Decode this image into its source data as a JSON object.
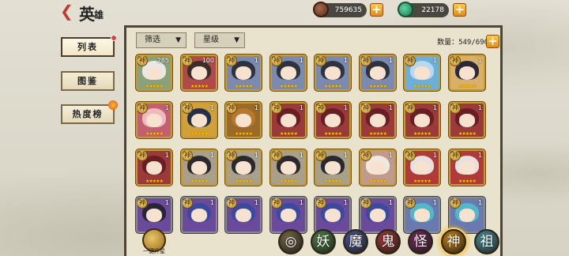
{
  "header": {
    "title_main": "英",
    "title_small": "雄",
    "coins": "759635",
    "jade": "22178",
    "plus": "+"
  },
  "sidebar": {
    "items": [
      {
        "label": "列表"
      },
      {
        "label": "图鉴"
      },
      {
        "label": "热度榜"
      }
    ]
  },
  "filters": {
    "filter_label": "筛选",
    "star_label": "星级",
    "count_label": "数量：549/690",
    "arrow": "▼"
  },
  "cards": [
    {
      "badge": "神",
      "level": "285",
      "hair": "#e8e8e8",
      "bg": "#8aa27a",
      "stars": "★★★★★"
    },
    {
      "badge": "神",
      "level": "100",
      "hair": "#3a2e2a",
      "bg": "#b04a4a",
      "stars": "★★★★★"
    },
    {
      "badge": "神",
      "level": "1",
      "hair": "#2f3340",
      "bg": "#7a8ab0",
      "stars": "★★★★★"
    },
    {
      "badge": "神",
      "level": "1",
      "hair": "#2f3340",
      "bg": "#7a8ab0",
      "stars": "★★★★★"
    },
    {
      "badge": "神",
      "level": "1",
      "hair": "#2f3340",
      "bg": "#7a8ab0",
      "stars": "★★★★★"
    },
    {
      "badge": "神",
      "level": "1",
      "hair": "#2f3340",
      "bg": "#7a8ab0",
      "stars": "★★★★★"
    },
    {
      "badge": "神",
      "level": "1",
      "hair": "#bcd8f0",
      "bg": "#6ab0d8",
      "stars": "★★★★★"
    },
    {
      "badge": "神",
      "level": "1",
      "hair": "#2a2a3a",
      "bg": "#d8b06a",
      "stars": "★★★★★"
    },
    {
      "badge": "神",
      "level": "1",
      "hair": "#f0b8c0",
      "bg": "#c06070",
      "stars": "★★★★★"
    },
    {
      "badge": "神",
      "level": "1",
      "hair": "#24304a",
      "bg": "#d0a03a",
      "stars": "★★★★★"
    },
    {
      "badge": "神",
      "level": "1",
      "hair": "#b8782a",
      "bg": "#9a6a2a",
      "stars": "★★★★★"
    },
    {
      "badge": "神",
      "level": "1",
      "hair": "#6a1e24",
      "bg": "#9a3a3a",
      "stars": "★★★★★"
    },
    {
      "badge": "神",
      "level": "1",
      "hair": "#6a1e24",
      "bg": "#9a3a3a",
      "stars": "★★★★★"
    },
    {
      "badge": "神",
      "level": "1",
      "hair": "#6a1e24",
      "bg": "#9a3a3a",
      "stars": "★★★★★"
    },
    {
      "badge": "神",
      "level": "1",
      "hair": "#6a1e24",
      "bg": "#9a3a3a",
      "stars": "★★★★★"
    },
    {
      "badge": "神",
      "level": "1",
      "hair": "#6a1e24",
      "bg": "#9a3a3a",
      "stars": "★★★★★"
    },
    {
      "badge": "神",
      "level": "1",
      "hair": "#6a1e24",
      "bg": "#9a3a3a",
      "stars": "★★★★★"
    },
    {
      "badge": "神",
      "level": "1",
      "hair": "#2a2a2e",
      "bg": "#a8a08a",
      "stars": "★★★★★"
    },
    {
      "badge": "神",
      "level": "1",
      "hair": "#2a2a2e",
      "bg": "#a8a08a",
      "stars": "★★★★★"
    },
    {
      "badge": "神",
      "level": "1",
      "hair": "#2a2a2e",
      "bg": "#a8a08a",
      "stars": "★★★★★"
    },
    {
      "badge": "神",
      "level": "1",
      "hair": "#2a2a2e",
      "bg": "#a8a08a",
      "stars": "★★★★★"
    },
    {
      "badge": "神",
      "level": "1",
      "hair": "#f0e8e0",
      "bg": "#c09a8a",
      "stars": "★★★★★"
    },
    {
      "badge": "神",
      "level": "1",
      "hair": "#e8e0e0",
      "bg": "#b03a3a",
      "stars": "★★★★★"
    },
    {
      "badge": "神",
      "level": "1",
      "hair": "#e8e0e0",
      "bg": "#b03a3a",
      "stars": "★★★★★"
    },
    {
      "badge": "神",
      "level": "1",
      "hair": "#2a2438",
      "bg": "#6a4a9a",
      "stars": ""
    },
    {
      "badge": "神",
      "level": "1",
      "hair": "#3a4aa0",
      "bg": "#6a4a9a",
      "stars": ""
    },
    {
      "badge": "神",
      "level": "1",
      "hair": "#3a4aa0",
      "bg": "#6a4a9a",
      "stars": ""
    },
    {
      "badge": "神",
      "level": "1",
      "hair": "#3a4aa0",
      "bg": "#6a4a9a",
      "stars": ""
    },
    {
      "badge": "神",
      "level": "1",
      "hair": "#3a4aa0",
      "bg": "#6a4a9a",
      "stars": ""
    },
    {
      "badge": "神",
      "level": "1",
      "hair": "#3a4aa0",
      "bg": "#6a4a9a",
      "stars": ""
    },
    {
      "badge": "神",
      "level": "1",
      "hair": "#50b8c8",
      "bg": "#6a7ab0",
      "stars": ""
    },
    {
      "badge": "神",
      "level": "1",
      "hair": "#50b8c8",
      "bg": "#6a7ab0",
      "stars": ""
    }
  ],
  "bottom": {
    "onekey_label": "一键升星",
    "categories": [
      {
        "label": "",
        "icon": "coin-filter-icon",
        "color": "#7a6a4a"
      },
      {
        "label": "妖",
        "color": "#4f8a4a"
      },
      {
        "label": "魔",
        "color": "#4a5aa0"
      },
      {
        "label": "鬼",
        "color": "#b03a3a"
      },
      {
        "label": "怪",
        "color": "#7a2a60"
      },
      {
        "label": "神",
        "color": "#d48a14"
      },
      {
        "label": "祖",
        "color": "#4a9aa8"
      }
    ]
  }
}
